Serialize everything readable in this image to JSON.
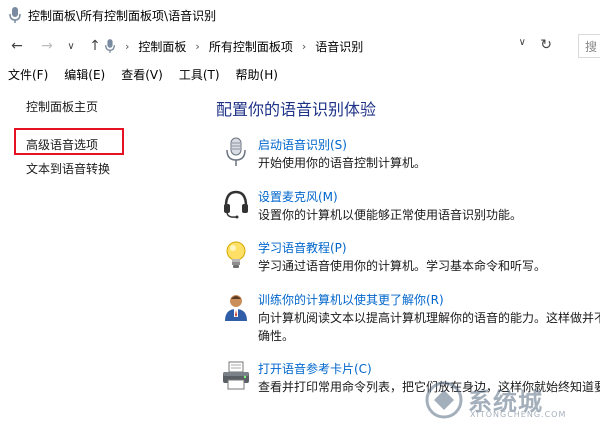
{
  "window": {
    "title": "控制面板\\所有控制面板项\\语音识别"
  },
  "address_bar": {
    "crumbs": [
      "控制面板",
      "所有控制面板项",
      "语音识别"
    ],
    "search_placeholder": "搜"
  },
  "menu": [
    "文件(F)",
    "编辑(E)",
    "查看(V)",
    "工具(T)",
    "帮助(H)"
  ],
  "sidebar": {
    "items": [
      "控制面板主页",
      "高级语音选项",
      "文本到语音转换"
    ]
  },
  "main": {
    "heading": "配置你的语音识别体验",
    "tasks": [
      {
        "icon": "microphone-icon",
        "link": "启动语音识别(S)",
        "desc": "开始使用你的语音控制计算机。"
      },
      {
        "icon": "headset-icon",
        "link": "设置麦克风(M)",
        "desc": "设置你的计算机以便能够正常使用语音识别功能。"
      },
      {
        "icon": "lightbulb-icon",
        "link": "学习语音教程(P)",
        "desc": "学习通过语音使用你的计算机。学习基本命令和听写。"
      },
      {
        "icon": "user-train-icon",
        "link": "训练你的计算机以使其更了解你(R)",
        "desc": "向计算机阅读文本以提高计算机理解你的语音的能力。这样做并不",
        "desc2": "确性。"
      },
      {
        "icon": "printer-icon",
        "link": "打开语音参考卡片(C)",
        "desc": "查看并打印常用命令列表，把它们放在身边，这样你就始终知道要"
      }
    ]
  },
  "watermark": {
    "text": "系统城",
    "sub": "XITONGCHENG.COM"
  }
}
